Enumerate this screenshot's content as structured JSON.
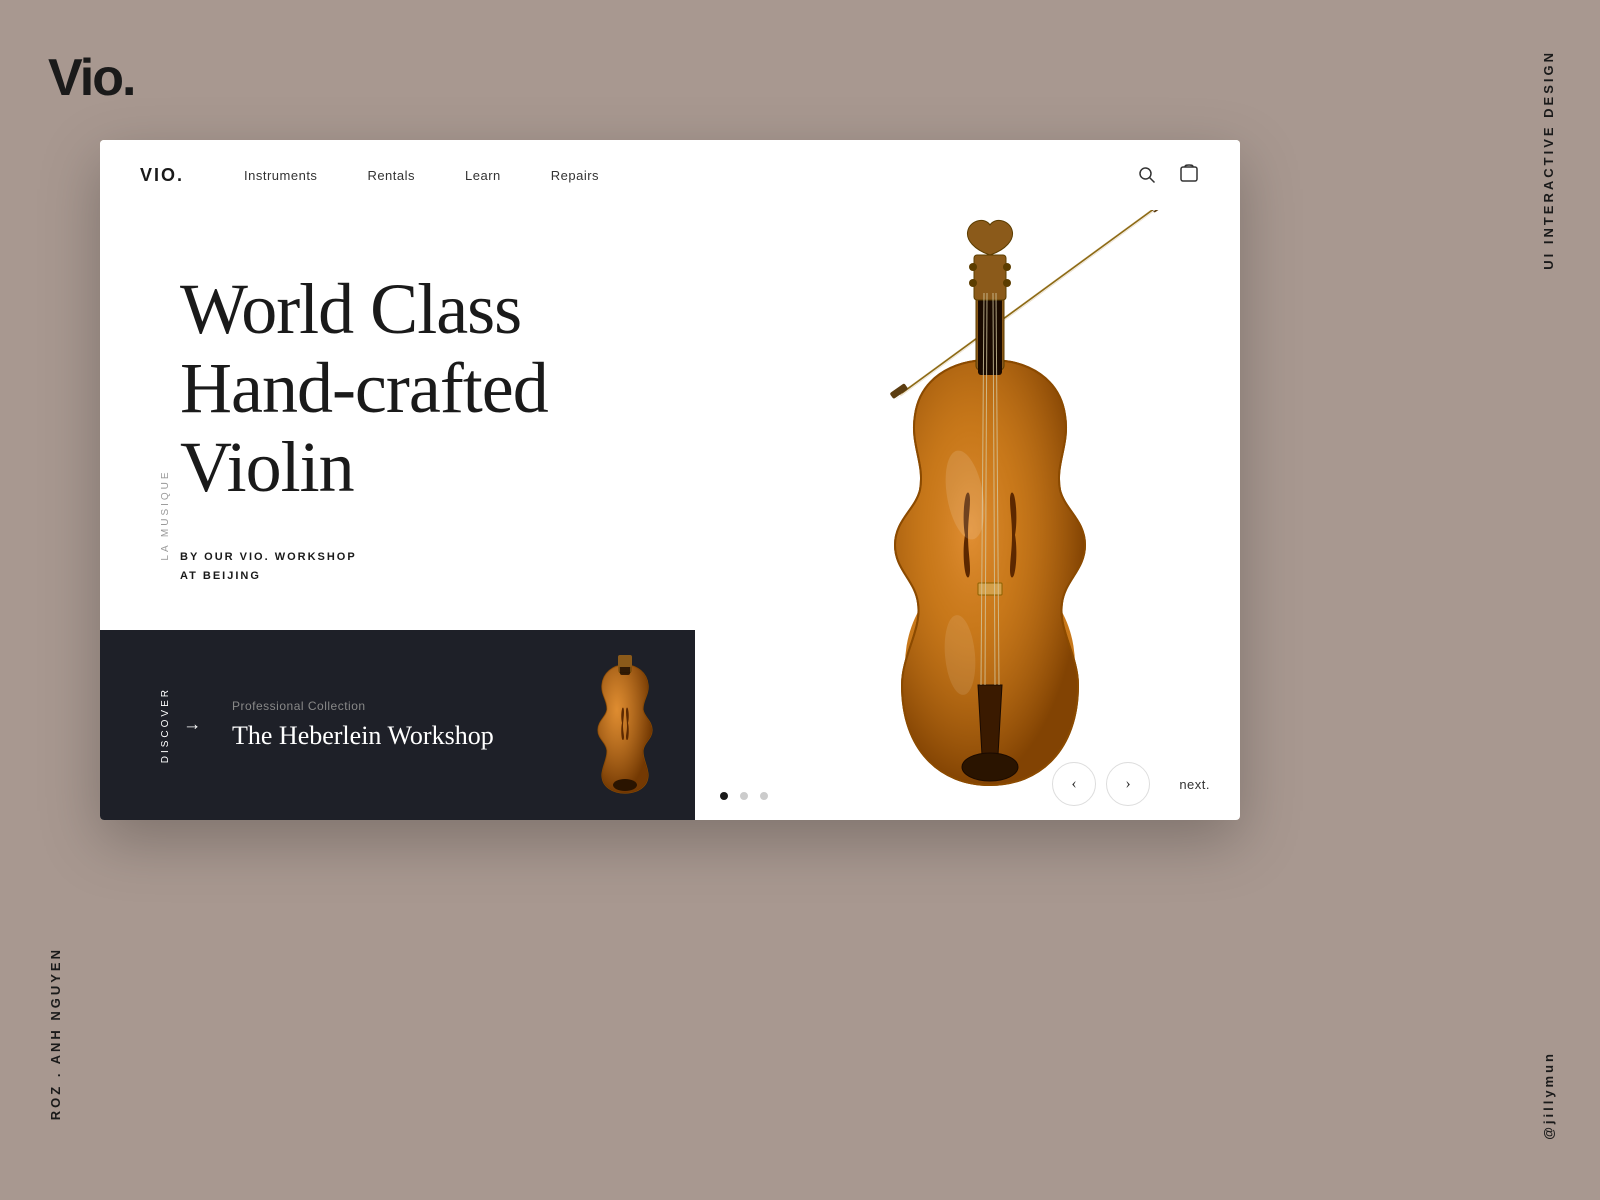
{
  "outer": {
    "logo": "Vio.",
    "interactive_label": "UI  INTERACTIVE DESIGN",
    "author_label": "ROZ . ANH  NGUYEN",
    "social_label": "@jillymun"
  },
  "nav": {
    "logo": "VIO.",
    "links": [
      "Instruments",
      "Rentals",
      "Learn",
      "Repairs"
    ]
  },
  "sidebar": {
    "text": "LA MUSIQUE"
  },
  "hero": {
    "title_line1": "World Class",
    "title_line2": "Hand-crafted",
    "title_line3": "Violin",
    "subtitle_line1": "BY OUR VIO. WORKSHOP",
    "subtitle_line2": "at Beijing"
  },
  "bottom_panel": {
    "discover": "DISCOVER",
    "collection": "Professional Collection",
    "title": "The Heberlein Workshop"
  },
  "pagination": {
    "dots": [
      true,
      false,
      false
    ]
  },
  "navigation": {
    "prev": "‹",
    "next_arrow": "›",
    "next_label": "next."
  }
}
